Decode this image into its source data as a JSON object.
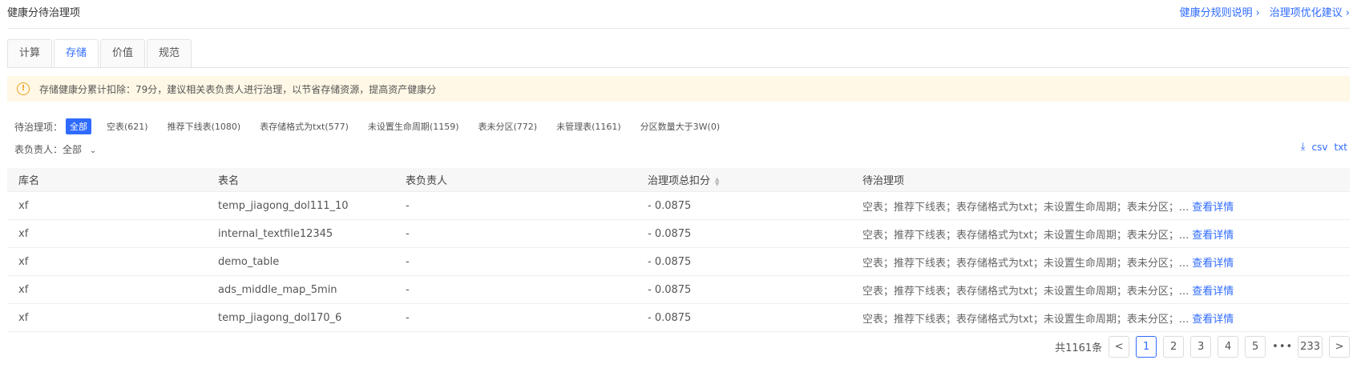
{
  "header": {
    "title": "健康分待治理项",
    "link_rules": "健康分规则说明",
    "link_suggest": "治理项优化建议"
  },
  "tabs": [
    {
      "label": "计算"
    },
    {
      "label": "存储"
    },
    {
      "label": "价值"
    },
    {
      "label": "规范"
    }
  ],
  "alert": {
    "text": "存储健康分累计扣除：79分，建议相关表负责人进行治理，以节省存储资源，提高资产健康分"
  },
  "filters": {
    "label": "待治理项：",
    "chips": [
      {
        "label": "全部"
      },
      {
        "label": "空表(621)"
      },
      {
        "label": "推荐下线表(1080)"
      },
      {
        "label": "表存储格式为txt(577)"
      },
      {
        "label": "未设置生命周期(1159)"
      },
      {
        "label": "表未分区(772)"
      },
      {
        "label": "未管理表(1161)"
      },
      {
        "label": "分区数量大于3W(0)"
      }
    ]
  },
  "owner_filter": {
    "label": "表负责人：",
    "value": "全部"
  },
  "export": {
    "csv": "csv",
    "txt": "txt"
  },
  "table": {
    "columns": [
      "库名",
      "表名",
      "表负责人",
      "治理项总扣分",
      "待治理项"
    ],
    "rows": [
      {
        "db": "xf",
        "table": "temp_jiagong_dol111_10",
        "owner": "-",
        "deduct": "- 0.0875",
        "pending": "空表；推荐下线表；表存储格式为txt；未设置生命周期；表未分区；...",
        "action": "查看详情"
      },
      {
        "db": "xf",
        "table": "internal_textfile12345",
        "owner": "-",
        "deduct": "- 0.0875",
        "pending": "空表；推荐下线表；表存储格式为txt；未设置生命周期；表未分区；...",
        "action": "查看详情"
      },
      {
        "db": "xf",
        "table": "demo_table",
        "owner": "-",
        "deduct": "- 0.0875",
        "pending": "空表；推荐下线表；表存储格式为txt；未设置生命周期；表未分区；...",
        "action": "查看详情"
      },
      {
        "db": "xf",
        "table": "ads_middle_map_5min",
        "owner": "-",
        "deduct": "- 0.0875",
        "pending": "空表；推荐下线表；表存储格式为txt；未设置生命周期；表未分区；...",
        "action": "查看详情"
      },
      {
        "db": "xf",
        "table": "temp_jiagong_dol170_6",
        "owner": "-",
        "deduct": "- 0.0875",
        "pending": "空表；推荐下线表；表存储格式为txt；未设置生命周期；表未分区；...",
        "action": "查看详情"
      }
    ]
  },
  "pagination": {
    "total": "共1161条",
    "pages": [
      "1",
      "2",
      "3",
      "4",
      "5"
    ],
    "ellipsis": "•••",
    "last": "233",
    "prev": "<",
    "next": ">"
  },
  "colors": {
    "accent": "#2f6bff",
    "alert_bg": "#fff8e6",
    "alert_icon": "#f0a020"
  }
}
